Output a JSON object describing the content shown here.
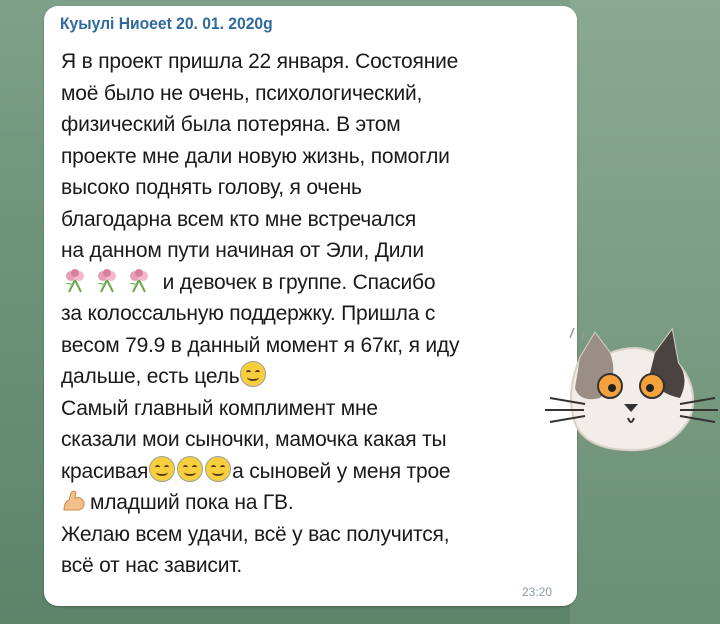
{
  "message": {
    "header": "Куыулі Ниоеet 20. 01. 2020g",
    "lines": [
      "Я в проект пришла 22 января. Состояние",
      "моё было не очень, психологический,",
      "физический была потеряна. В этом",
      "проекте мне дали новую жизнь, помогли",
      "высоко поднять голову, я очень",
      "благодарна всем кто мне встречался",
      "на данном пути начиная от Эли, Дили",
      "и девочек в группе. Спасибо",
      "за колоссальную поддержку. Пришла с",
      "весом 79.9 в данный момент я 67кг, я иду",
      "дальше, есть цель",
      "Самый главный комплимент мне",
      "сказали мои сыночки, мамочка какая ты",
      "красивая",
      "а сыновей у меня трое",
      "младший пока на ГВ.",
      "Желаю всем удачи, всё у вас получится,",
      "всё от нас зависит."
    ],
    "time": "23:20"
  },
  "icons": {
    "flower": "rose-bouquet-icon",
    "smile": "smiling-face-icon",
    "arm": "flexed-biceps-icon",
    "sticker": "cat-sticker"
  }
}
